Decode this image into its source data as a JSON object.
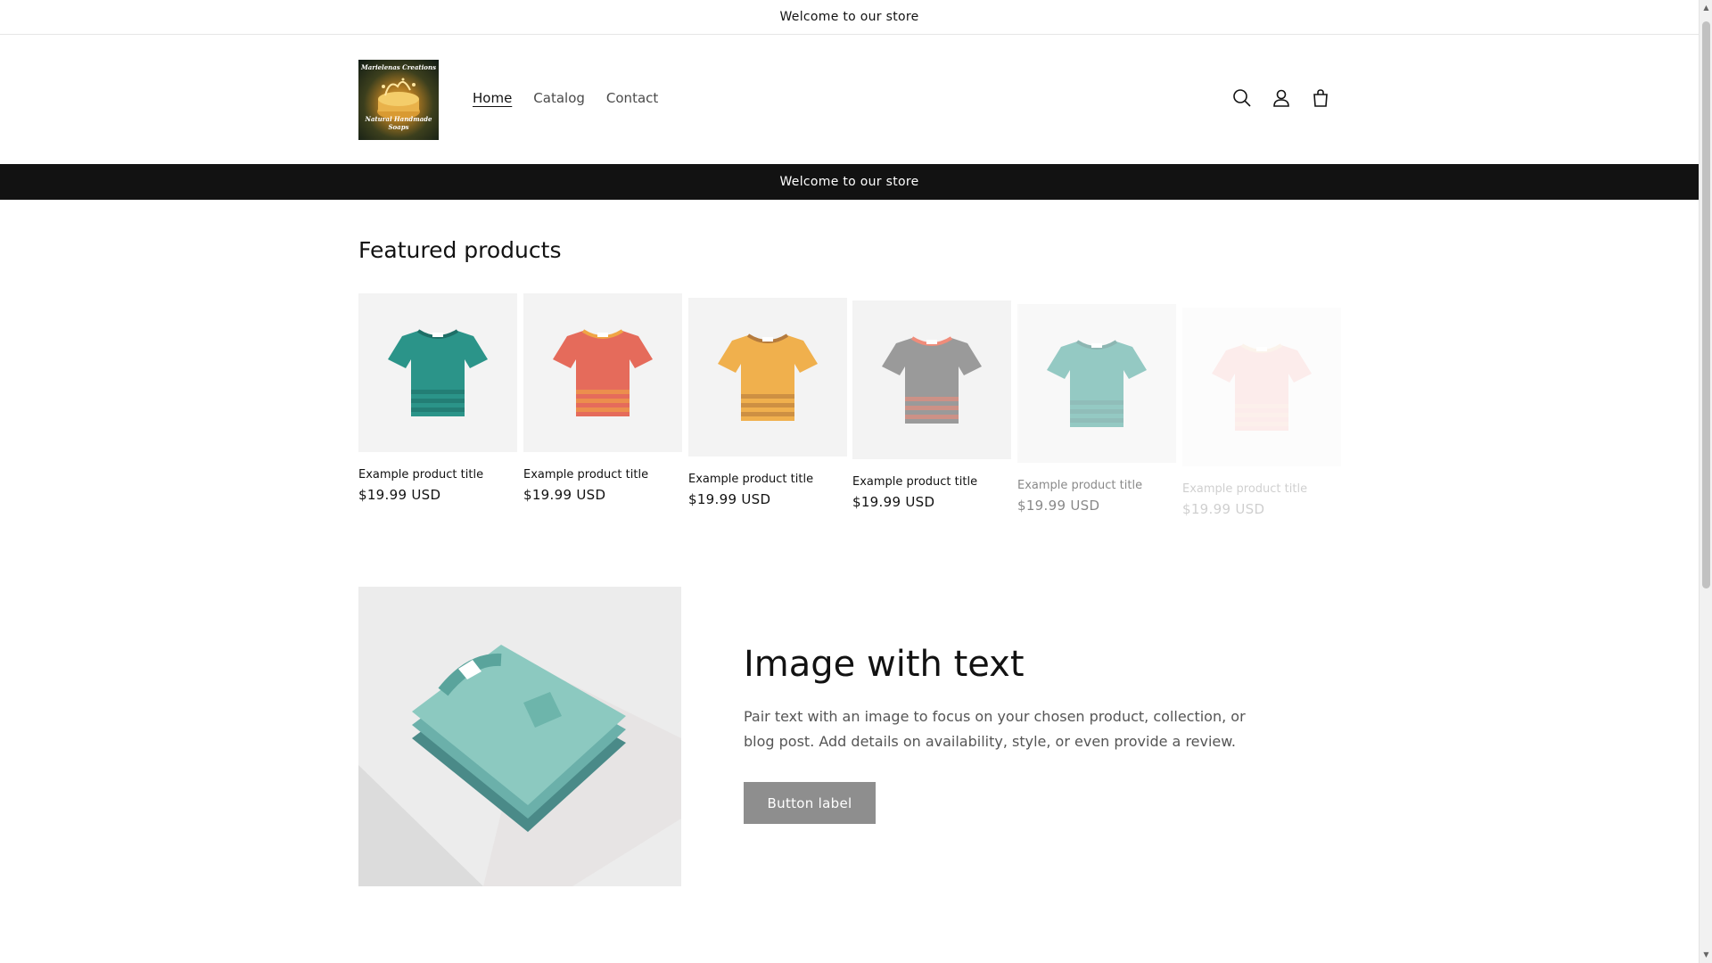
{
  "announcement_top": "Welcome to our store",
  "header": {
    "logo": {
      "top_text": "Marielenas Creations",
      "bottom_text": "Natural Handmade Soaps"
    },
    "nav": [
      {
        "label": "Home",
        "active": true
      },
      {
        "label": "Catalog",
        "active": false
      },
      {
        "label": "Contact",
        "active": false
      }
    ],
    "icons": [
      "search-icon",
      "account-icon",
      "cart-icon"
    ]
  },
  "announcement_bar": "Welcome to our store",
  "featured": {
    "title": "Featured products",
    "products": [
      {
        "title": "Example product title",
        "price": "$19.99 USD",
        "shirt_color": "#2b9489",
        "accent": "#1e6f67",
        "opacity": 1
      },
      {
        "title": "Example product title",
        "price": "$19.99 USD",
        "shirt_color": "#e56b5b",
        "accent": "#f0a545",
        "opacity": 1
      },
      {
        "title": "Example product title",
        "price": "$19.99 USD",
        "shirt_color": "#f0b04d",
        "accent": "#b57b3d",
        "opacity": 1
      },
      {
        "title": "Example product title",
        "price": "$19.99 USD",
        "shirt_color": "#9a9a9a",
        "accent": "#f08c7a",
        "opacity": 1
      },
      {
        "title": "Example product title",
        "price": "$19.99 USD",
        "shirt_color": "#2b9489",
        "accent": "#1e6f67",
        "opacity": 0.5
      },
      {
        "title": "Example product title",
        "price": "$19.99 USD",
        "shirt_color": "#f5a6a0",
        "accent": "#f0c7a0",
        "opacity": 0.2
      }
    ]
  },
  "image_with_text": {
    "title": "Image with text",
    "body": "Pair text with an image to focus on your chosen product, collection, or blog post. Add details on availability, style, or even provide a review.",
    "button_label": "Button label"
  },
  "colors": {
    "text": "#121212",
    "announcement_bg": "#121212",
    "button_bg": "#8e8e8e",
    "card_bg": "#f3f3f3"
  }
}
